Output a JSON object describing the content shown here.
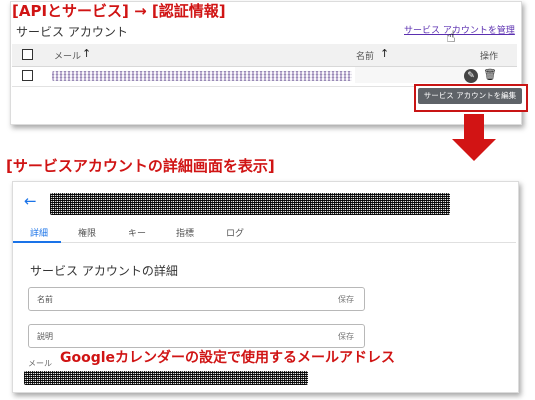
{
  "captions": {
    "top": "[APIとサービス] → [認証情報]",
    "middle": "[サービスアカウントの詳細画面を表示]",
    "bottom": "Googleカレンダーの設定で使用するメールアドレス"
  },
  "list_page": {
    "title": "サービス アカウント",
    "manage_link": "サービス アカウントを管理",
    "columns": {
      "email": "メール",
      "name": "名前",
      "actions": "操作"
    },
    "sort_arrow": "↑",
    "tooltip": "サービス アカウントを編集"
  },
  "details_page": {
    "tabs": [
      "詳細",
      "権限",
      "キー",
      "指標",
      "ログ"
    ],
    "active_tab": "詳細",
    "section_title": "サービス アカウントの詳細",
    "fields": [
      {
        "label": "名前",
        "action": "保存"
      },
      {
        "label": "説明",
        "action": "保存"
      }
    ],
    "email_label": "メール"
  },
  "colors": {
    "caption_red": "#d01414",
    "link_purple": "#5b2fb0",
    "accent_blue": "#1a73e8",
    "tooltip_bg": "#5f6368"
  },
  "icons": [
    "pencil-icon",
    "trash-icon",
    "back-arrow-icon",
    "down-arrow-icon"
  ]
}
